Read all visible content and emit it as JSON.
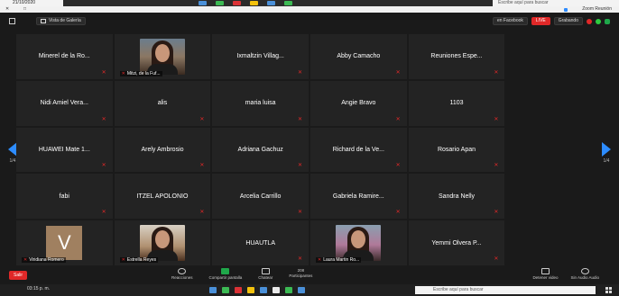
{
  "top_taskbar": {
    "left_text": "21/10/2020",
    "search_text": "Escribe aquí para buscar"
  },
  "browser": {
    "tab_title": "Zoom Reunión",
    "close_label": "✕",
    "window_label": "□"
  },
  "header": {
    "view_label": "Vista de Galería",
    "live_label": "LIVE",
    "live_target": "en Facebook",
    "recording_label": "Grabando"
  },
  "participants": [
    {
      "name": "Minerel de la Ro..."
    },
    {
      "name": "Mitzi, de la Fuf...",
      "video": "v1"
    },
    {
      "name": "Ixmaltzin Villag..."
    },
    {
      "name": "Abby Camacho"
    },
    {
      "name": "Reuniones Espe..."
    },
    {
      "name": ""
    },
    {
      "name": "Nidi Amiel Vera..."
    },
    {
      "name": "alis"
    },
    {
      "name": "maria luisa"
    },
    {
      "name": "Angie Bravo"
    },
    {
      "name": "1103"
    },
    {
      "name": ""
    },
    {
      "name": "HUAWEI Mate 1..."
    },
    {
      "name": "Arely Ambrosio"
    },
    {
      "name": "Adriana Gachuz"
    },
    {
      "name": "Richard de la Ve..."
    },
    {
      "name": "Rosario Apan"
    },
    {
      "name": ""
    },
    {
      "name": "fabi"
    },
    {
      "name": "ITZEL APOLONIO"
    },
    {
      "name": "Arcelia Carrillo"
    },
    {
      "name": "Gabriela Ramire..."
    },
    {
      "name": "Sandra Nelly"
    },
    {
      "name": ""
    },
    {
      "name": "Viridiana Romero",
      "avatar": "V"
    },
    {
      "name": "Estrella Reyes",
      "video": "v2"
    },
    {
      "name": "HUAUTLA"
    },
    {
      "name": "Laura Martin Ro...",
      "video": "v3"
    },
    {
      "name": "Yemmi Olvera P..."
    },
    {
      "name": ""
    }
  ],
  "nav": {
    "left_page": "1/4",
    "right_page": "1/4"
  },
  "toolbar": {
    "end_label": "Salir",
    "participants_count": "208",
    "items": [
      {
        "label": "Reacciones"
      },
      {
        "label": "Compartir pantalla"
      },
      {
        "label": "Chatear"
      },
      {
        "label": "Participantes"
      }
    ],
    "right_items": [
      {
        "label": "Detener video"
      },
      {
        "label": "Sin Audio Audio"
      }
    ]
  },
  "bottom_taskbar": {
    "clock": "03:15 p. m.",
    "search_text": "Escribe aquí para buscar"
  }
}
